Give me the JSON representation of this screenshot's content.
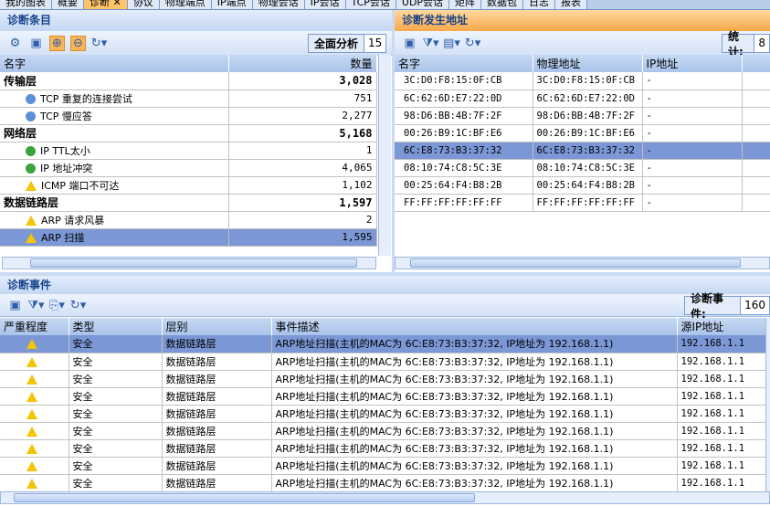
{
  "tabs": [
    "我的图表",
    "概要",
    "诊断 ✕",
    "协议",
    "物理端点",
    "IP端点",
    "物理会话",
    "IP会话",
    "TCP会话",
    "UDP会话",
    "矩阵",
    "数据包",
    "日志",
    "报表"
  ],
  "active_tab": 2,
  "left": {
    "title": "诊断条目",
    "analyze_label": "全面分析",
    "analyze_value": "15",
    "columns": [
      "名字",
      "数量"
    ],
    "rows": [
      {
        "name": "传输层",
        "count": "3,028",
        "group": true
      },
      {
        "name": "TCP 重复的连接尝试",
        "count": "751",
        "icon": "info"
      },
      {
        "name": "TCP 慢应答",
        "count": "2,277",
        "icon": "info"
      },
      {
        "name": "网络层",
        "count": "5,168",
        "group": true
      },
      {
        "name": "IP TTL太小",
        "count": "1",
        "icon": "ok"
      },
      {
        "name": "IP 地址冲突",
        "count": "4,065",
        "icon": "ok"
      },
      {
        "name": "ICMP 端口不可达",
        "count": "1,102",
        "icon": "warn"
      },
      {
        "name": "数据链路层",
        "count": "1,597",
        "group": true
      },
      {
        "name": "ARP 请求风暴",
        "count": "2",
        "icon": "warn"
      },
      {
        "name": "ARP 扫描",
        "count": "1,595",
        "icon": "warn",
        "selected": true
      }
    ]
  },
  "right": {
    "title": "诊断发生地址",
    "stat_label": "统计:",
    "stat_value": "8",
    "columns": [
      "名字",
      "物理地址",
      "IP地址"
    ],
    "rows": [
      [
        "3C:D0:F8:15:0F:CB",
        "3C:D0:F8:15:0F:CB",
        "-"
      ],
      [
        "6C:62:6D:E7:22:0D",
        "6C:62:6D:E7:22:0D",
        "-"
      ],
      [
        "98:D6:BB:4B:7F:2F",
        "98:D6:BB:4B:7F:2F",
        "-"
      ],
      [
        "00:26:B9:1C:BF:E6",
        "00:26:B9:1C:BF:E6",
        "-"
      ],
      [
        "6C:E8:73:B3:37:32",
        "6C:E8:73:B3:37:32",
        "-"
      ],
      [
        "08:10:74:C8:5C:3E",
        "08:10:74:C8:5C:3E",
        "-"
      ],
      [
        "00:25:64:F4:B8:2B",
        "00:25:64:F4:B8:2B",
        "-"
      ],
      [
        "FF:FF:FF:FF:FF:FF",
        "FF:FF:FF:FF:FF:FF",
        "-"
      ]
    ],
    "selected": 4
  },
  "bottom": {
    "title": "诊断事件",
    "count_label": "诊断事件:",
    "count_value": "160",
    "columns": [
      "严重程度",
      "类型",
      "层别",
      "事件描述",
      "源IP地址"
    ],
    "row": {
      "type": "安全",
      "layer": "数据链路层",
      "desc": "ARP地址扫描(主机的MAC为 6C:E8:73:B3:37:32, IP地址为 192.168.1.1)",
      "src": "192.168.1.1"
    },
    "row_count": 9
  }
}
